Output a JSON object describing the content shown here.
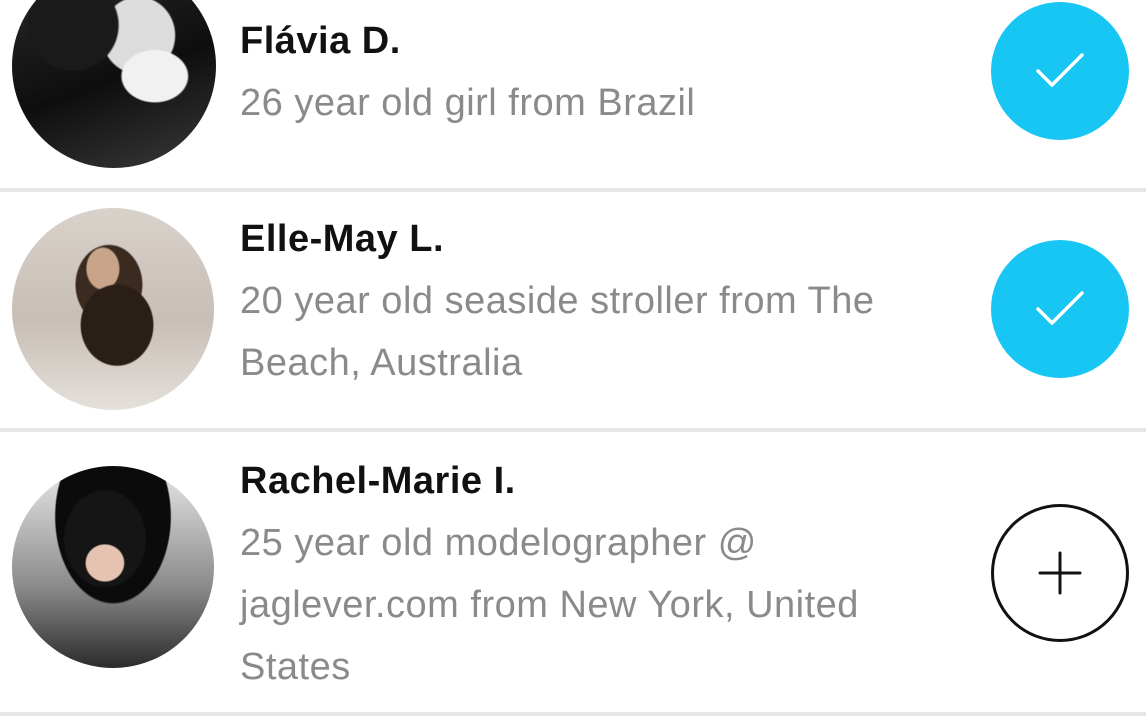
{
  "users": [
    {
      "name": "Flávia D.",
      "description": "26 year old girl from Brazil",
      "avatar_icon": "avatar-photo",
      "action_icon": "checkmark-icon",
      "action_state": "followed"
    },
    {
      "name": "Elle-May L.",
      "description": "20 year old seaside stroller  from The Beach, Australia",
      "avatar_icon": "avatar-photo",
      "action_icon": "checkmark-icon",
      "action_state": "followed"
    },
    {
      "name": "Rachel-Marie I.",
      "description": "25 year old modelographer @ jaglever.com from New York, United States",
      "avatar_icon": "avatar-photo",
      "action_icon": "plus-icon",
      "action_state": "not-followed"
    }
  ],
  "colors": {
    "accent": "#17c6f2",
    "name_text": "#111111",
    "description_text": "#8a8a8a",
    "divider": "#e6e6e6"
  }
}
